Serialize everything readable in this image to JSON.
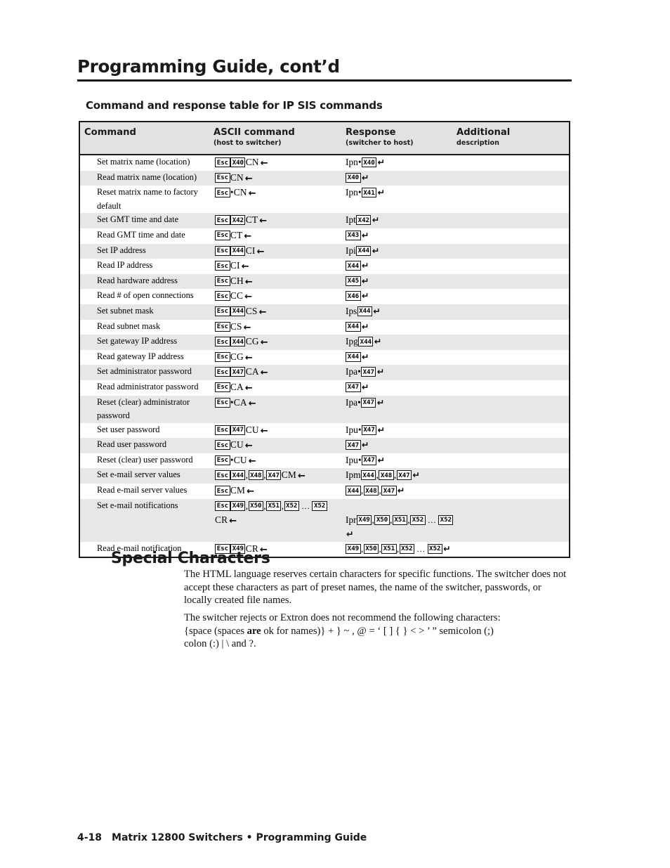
{
  "page": {
    "title": "Programming Guide, cont’d",
    "section_subtitle": "Command and response table for IP SIS commands",
    "footer_page_number": "4-18",
    "footer_text": "Matrix 12800 Switchers • Programming Guide"
  },
  "table": {
    "headers": [
      {
        "main": "Command",
        "sub": ""
      },
      {
        "main": "ASCII command",
        "sub": "(host to switcher)"
      },
      {
        "main": "Response",
        "sub": "(switcher to host)"
      },
      {
        "main": "Additional",
        "sub": "description"
      }
    ],
    "rows": [
      {
        "command": "Set matrix name (location)",
        "ascii_pre": "",
        "ascii_tokens": [
          "X40"
        ],
        "ascii_post": "CN",
        "resp_pre": "Ipn•",
        "resp_tokens": [
          "X40"
        ],
        "additional": "",
        "shaded": false
      },
      {
        "command": "Read matrix name (location)",
        "ascii_pre": "",
        "ascii_tokens": [],
        "ascii_post": "CN",
        "resp_pre": "",
        "resp_tokens": [
          "X40"
        ],
        "additional": "",
        "shaded": true
      },
      {
        "command": "Reset matrix name to factory default",
        "ascii_pre": "•",
        "ascii_tokens": [],
        "ascii_post": "CN",
        "resp_pre": "Ipn•",
        "resp_tokens": [
          "X41"
        ],
        "additional": "",
        "shaded": false
      },
      {
        "command": "Set GMT time and date",
        "ascii_pre": "",
        "ascii_tokens": [
          "X42"
        ],
        "ascii_post": "CT",
        "resp_pre": "Ipt",
        "resp_tokens": [
          "X42"
        ],
        "additional": "",
        "shaded": true
      },
      {
        "command": "Read GMT time and date",
        "ascii_pre": "",
        "ascii_tokens": [],
        "ascii_post": "CT",
        "resp_pre": "",
        "resp_tokens": [
          "X43"
        ],
        "additional": "",
        "shaded": false
      },
      {
        "command": "Set IP address",
        "ascii_pre": "",
        "ascii_tokens": [
          "X44"
        ],
        "ascii_post": "CI",
        "resp_pre": "Ipi",
        "resp_tokens": [
          "X44"
        ],
        "additional": "",
        "shaded": true
      },
      {
        "command": "Read IP address",
        "ascii_pre": "",
        "ascii_tokens": [],
        "ascii_post": "CI",
        "resp_pre": "",
        "resp_tokens": [
          "X44"
        ],
        "additional": "",
        "shaded": false
      },
      {
        "command": "Read hardware address",
        "ascii_pre": "",
        "ascii_tokens": [],
        "ascii_post": "CH",
        "resp_pre": "",
        "resp_tokens": [
          "X45"
        ],
        "additional": "",
        "shaded": true
      },
      {
        "command": "Read # of open connections",
        "ascii_pre": "",
        "ascii_tokens": [],
        "ascii_post": "CC",
        "resp_pre": "",
        "resp_tokens": [
          "X46"
        ],
        "additional": "",
        "shaded": false
      },
      {
        "command": "Set subnet mask",
        "ascii_pre": "",
        "ascii_tokens": [
          "X44"
        ],
        "ascii_post": "CS",
        "resp_pre": "Ips",
        "resp_tokens": [
          "X44"
        ],
        "additional": "",
        "shaded": true
      },
      {
        "command": "Read subnet mask",
        "ascii_pre": "",
        "ascii_tokens": [],
        "ascii_post": "CS",
        "resp_pre": "",
        "resp_tokens": [
          "X44"
        ],
        "additional": "",
        "shaded": false
      },
      {
        "command": "Set gateway IP address",
        "ascii_pre": "",
        "ascii_tokens": [
          "X44"
        ],
        "ascii_post": "CG",
        "resp_pre": "Ipg",
        "resp_tokens": [
          "X44"
        ],
        "additional": "",
        "shaded": true
      },
      {
        "command": "Read gateway IP address",
        "ascii_pre": "",
        "ascii_tokens": [],
        "ascii_post": "CG",
        "resp_pre": "",
        "resp_tokens": [
          "X44"
        ],
        "additional": "",
        "shaded": false
      },
      {
        "command": "Set administrator password",
        "ascii_pre": "",
        "ascii_tokens": [
          "X47"
        ],
        "ascii_post": "CA",
        "resp_pre": "Ipa•",
        "resp_tokens": [
          "X47"
        ],
        "additional": "",
        "shaded": true
      },
      {
        "command": "Read administrator password",
        "ascii_pre": "",
        "ascii_tokens": [],
        "ascii_post": "CA",
        "resp_pre": "",
        "resp_tokens": [
          "X47"
        ],
        "additional": "",
        "shaded": false
      },
      {
        "command": "Reset (clear) administrator password",
        "ascii_pre": "•",
        "ascii_tokens": [],
        "ascii_post": "CA",
        "resp_pre": "Ipa•",
        "resp_tokens": [
          "X47"
        ],
        "additional": "",
        "shaded": true
      },
      {
        "command": "Set user password",
        "ascii_pre": "",
        "ascii_tokens": [
          "X47"
        ],
        "ascii_post": "CU",
        "resp_pre": "Ipu•",
        "resp_tokens": [
          "X47"
        ],
        "additional": "",
        "shaded": false
      },
      {
        "command": "Read user password",
        "ascii_pre": "",
        "ascii_tokens": [],
        "ascii_post": "CU",
        "resp_pre": "",
        "resp_tokens": [
          "X47"
        ],
        "additional": "",
        "shaded": true
      },
      {
        "command": "Reset (clear) user password",
        "ascii_pre": "•",
        "ascii_tokens": [],
        "ascii_post": "CU",
        "resp_pre": "Ipu•",
        "resp_tokens": [
          "X47"
        ],
        "additional": "",
        "shaded": false
      },
      {
        "command": "Set e-mail server values",
        "ascii_pre": "",
        "ascii_tokens": [
          "X44",
          "X48",
          "X47"
        ],
        "ascii_post": "CM",
        "resp_pre": "Ipm",
        "resp_tokens": [
          "X44",
          "X48",
          "X47"
        ],
        "additional": "",
        "shaded": true
      },
      {
        "command": "Read e-mail server values",
        "ascii_pre": "",
        "ascii_tokens": [],
        "ascii_post": "CM",
        "resp_pre": "",
        "resp_tokens": [
          "X44",
          "X48",
          "X47"
        ],
        "additional": "",
        "shaded": false
      },
      {
        "command": "Set e-mail notifications",
        "ascii_pre": "",
        "ascii_tokens": [
          "X49",
          "X50",
          "X51",
          "X52",
          "…",
          "X52"
        ],
        "ascii_post": "CR",
        "resp_pre": "Ipr",
        "resp_tokens": [
          "X49",
          "X50",
          "X51",
          "X52",
          "…",
          "X52"
        ],
        "additional": "",
        "shaded": true,
        "two_line": true
      },
      {
        "command": "Read e-mail notification",
        "ascii_pre": "",
        "ascii_tokens": [
          "X49"
        ],
        "ascii_post": "CR",
        "resp_pre": "",
        "resp_tokens": [
          "X49",
          "X50",
          "X51",
          "X52",
          "…",
          "X52"
        ],
        "additional": "",
        "shaded": false
      }
    ],
    "esc_label": "Esc",
    "left_arrow_glyph": "←",
    "cr_arrow_glyph": "↵"
  },
  "special_characters": {
    "heading": "Special Characters",
    "paragraph_1": "The HTML language reserves certain characters for specific functions.  The switcher does not accept these characters as part of preset names, the name of the switcher, passwords, or locally created file names.",
    "paragraph_2_line1": "The switcher rejects or Extron does not recommend the following characters:",
    "paragraph_2_line2_a": "{space (spaces ",
    "paragraph_2_bold": "are",
    "paragraph_2_line2_b": " ok for names)}  +  }  ~  ,  @  =  ‘  [  ]  {  }  <  >  ’  ”  semicolon (;)",
    "paragraph_2_line3": "colon (:)  |  \\  and ?."
  },
  "colors": {
    "ink": "#1a1a1a",
    "header_fill": "#e2e2e2",
    "row_shade": "#e7e7e7",
    "row_plain": "#ffffff"
  }
}
